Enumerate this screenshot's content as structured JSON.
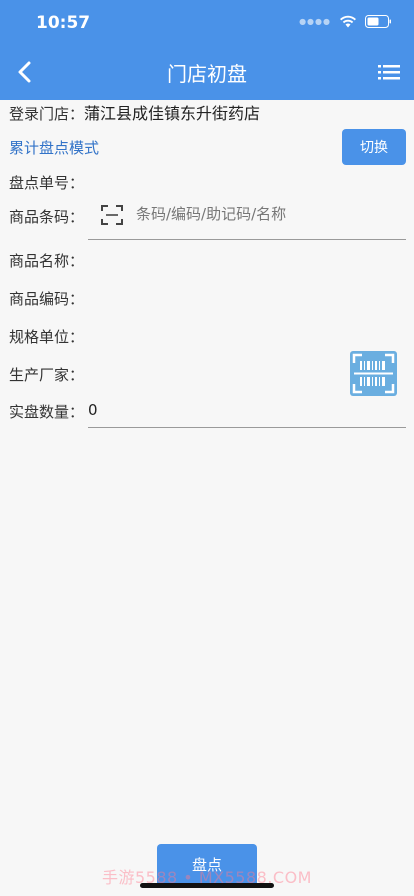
{
  "status_bar": {
    "time": "10:57"
  },
  "nav": {
    "title": "门店初盘"
  },
  "form": {
    "store_label": "登录门店：",
    "store_value": "蒲江县成佳镇东升街药店",
    "mode_text": "累计盘点模式",
    "switch_label": "切换",
    "order_no_label": "盘点单号：",
    "barcode_label": "商品条码：",
    "barcode_placeholder": "条码/编码/助记码/名称",
    "name_label": "商品名称：",
    "code_label": "商品编码：",
    "spec_label": "规格单位：",
    "manufacturer_label": "生产厂家：",
    "qty_label": "实盘数量：",
    "qty_value": "0"
  },
  "footer": {
    "submit_label": "盘点",
    "watermark": "手游5588 • MX5588.COM"
  },
  "colors": {
    "primary": "#4a92e8",
    "mode_text": "#3273c8"
  }
}
